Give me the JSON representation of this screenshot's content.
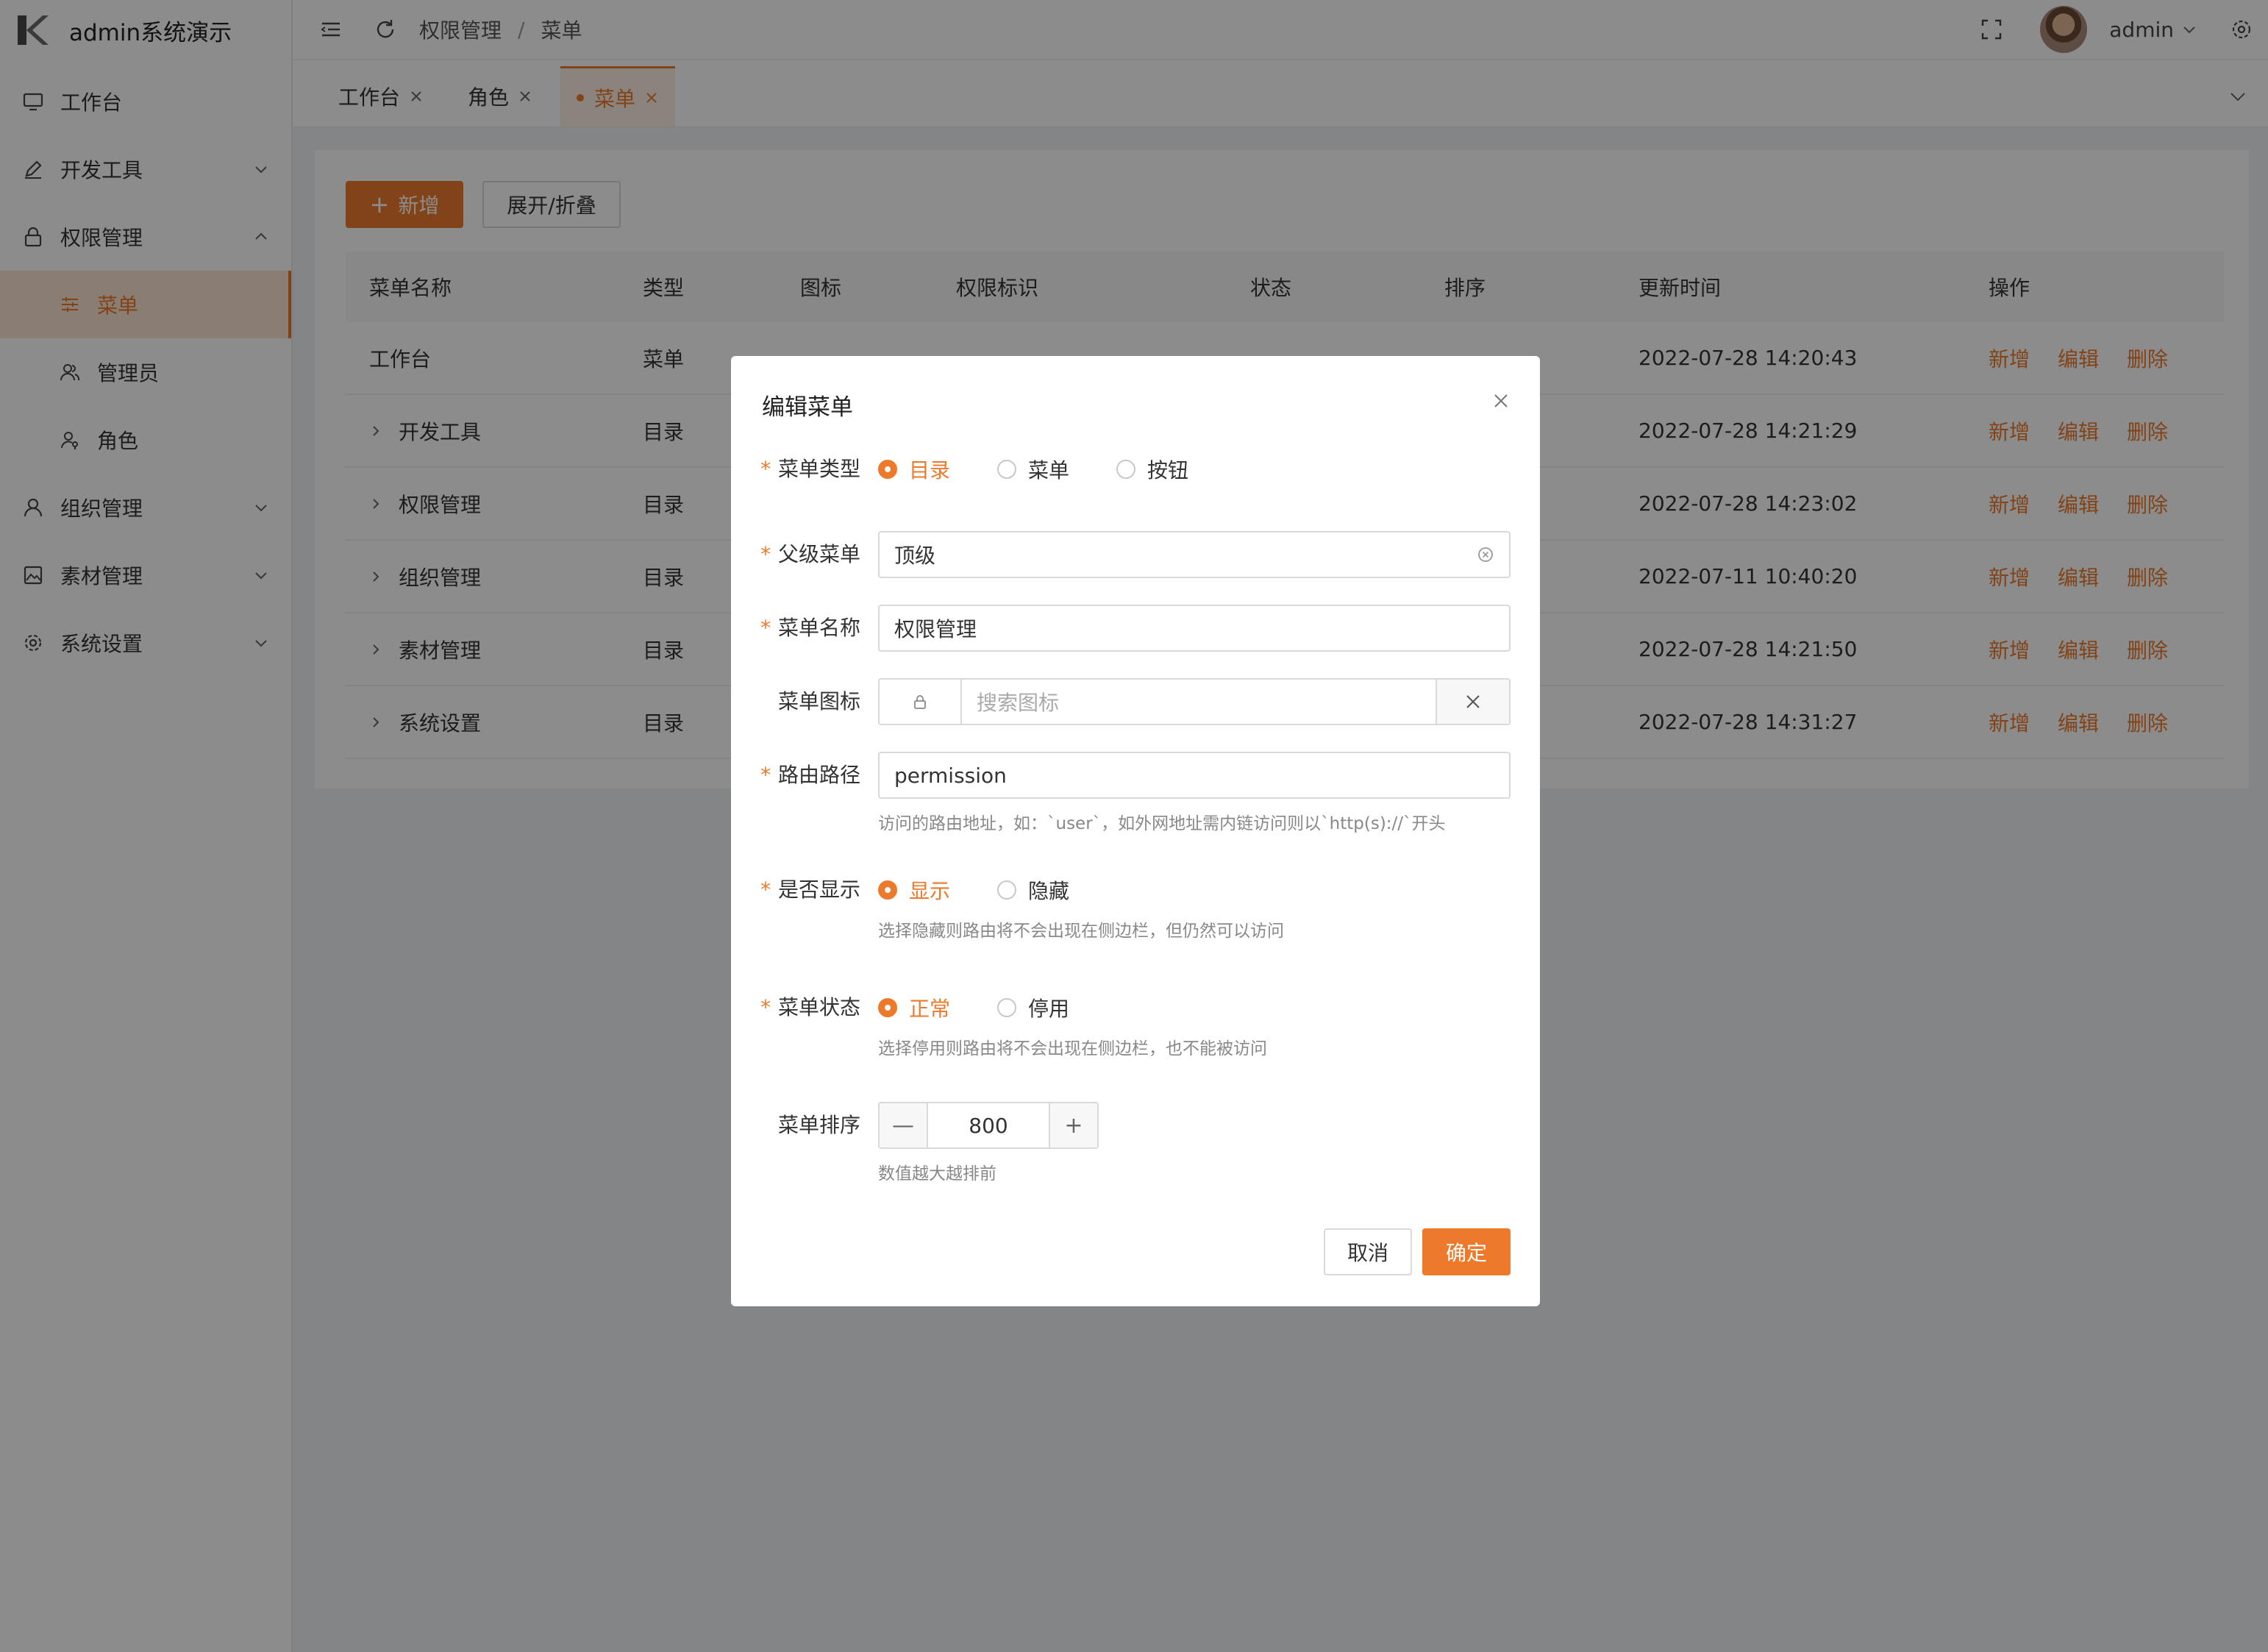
{
  "app": {
    "title": "admin系统演示"
  },
  "sidebar": {
    "items": [
      {
        "label": "工作台",
        "icon": "monitor-icon"
      },
      {
        "label": "开发工具",
        "icon": "pen-icon"
      },
      {
        "label": "权限管理",
        "icon": "lock-icon"
      },
      {
        "label": "菜单",
        "icon": "sliders-icon"
      },
      {
        "label": "管理员",
        "icon": "users-icon"
      },
      {
        "label": "角色",
        "icon": "user-key-icon"
      },
      {
        "label": "组织管理",
        "icon": "user-icon"
      },
      {
        "label": "素材管理",
        "icon": "image-icon"
      },
      {
        "label": "系统设置",
        "icon": "gear-icon"
      }
    ]
  },
  "header": {
    "breadcrumb": [
      "权限管理",
      "菜单"
    ],
    "breadcrumb_sep": "/",
    "user": "admin"
  },
  "tabs": [
    {
      "label": "工作台"
    },
    {
      "label": "角色"
    },
    {
      "label": "菜单"
    }
  ],
  "toolbar": {
    "add_label": "新增",
    "add_plus": "+",
    "toggle_label": "展开/折叠"
  },
  "table": {
    "columns": [
      "菜单名称",
      "类型",
      "图标",
      "权限标识",
      "状态",
      "排序",
      "更新时间",
      "操作"
    ],
    "rows": [
      {
        "name": "工作台",
        "type": "菜单",
        "time": "2022-07-28 14:20:43"
      },
      {
        "name": "开发工具",
        "type": "目录",
        "time": "2022-07-28 14:21:29"
      },
      {
        "name": "权限管理",
        "type": "目录",
        "time": "2022-07-28 14:23:02"
      },
      {
        "name": "组织管理",
        "type": "目录",
        "time": "2022-07-11 10:40:20"
      },
      {
        "name": "素材管理",
        "type": "目录",
        "time": "2022-07-28 14:21:50"
      },
      {
        "name": "系统设置",
        "type": "目录",
        "time": "2022-07-28 14:31:27"
      }
    ],
    "ops": [
      "新增",
      "编辑",
      "删除"
    ]
  },
  "modal": {
    "title": "编辑菜单",
    "required_mark": "*",
    "type": {
      "label": "菜单类型",
      "options": [
        "目录",
        "菜单",
        "按钮"
      ],
      "selected": "目录"
    },
    "parent": {
      "label": "父级菜单",
      "value": "顶级"
    },
    "name": {
      "label": "菜单名称",
      "value": "权限管理"
    },
    "icon": {
      "label": "菜单图标",
      "placeholder": "搜索图标"
    },
    "path": {
      "label": "路由路径",
      "value": "permission",
      "hint": "访问的路由地址，如：`user`，如外网地址需内链访问则以`http(s)://`开头"
    },
    "show": {
      "label": "是否显示",
      "options": [
        "显示",
        "隐藏"
      ],
      "selected": "显示",
      "hint": "选择隐藏则路由将不会出现在侧边栏，但仍然可以访问"
    },
    "status": {
      "label": "菜单状态",
      "options": [
        "正常",
        "停用"
      ],
      "selected": "正常",
      "hint": "选择停用则路由将不会出现在侧边栏，也不能被访问"
    },
    "sort": {
      "label": "菜单排序",
      "value": "800",
      "minus": "—",
      "plus": "+",
      "hint": "数值越大越排前"
    },
    "cancel": "取消",
    "ok": "确定"
  },
  "colors": {
    "accent": "#ec7a2a",
    "overlay": "rgba(0,0,0,0.45)"
  }
}
